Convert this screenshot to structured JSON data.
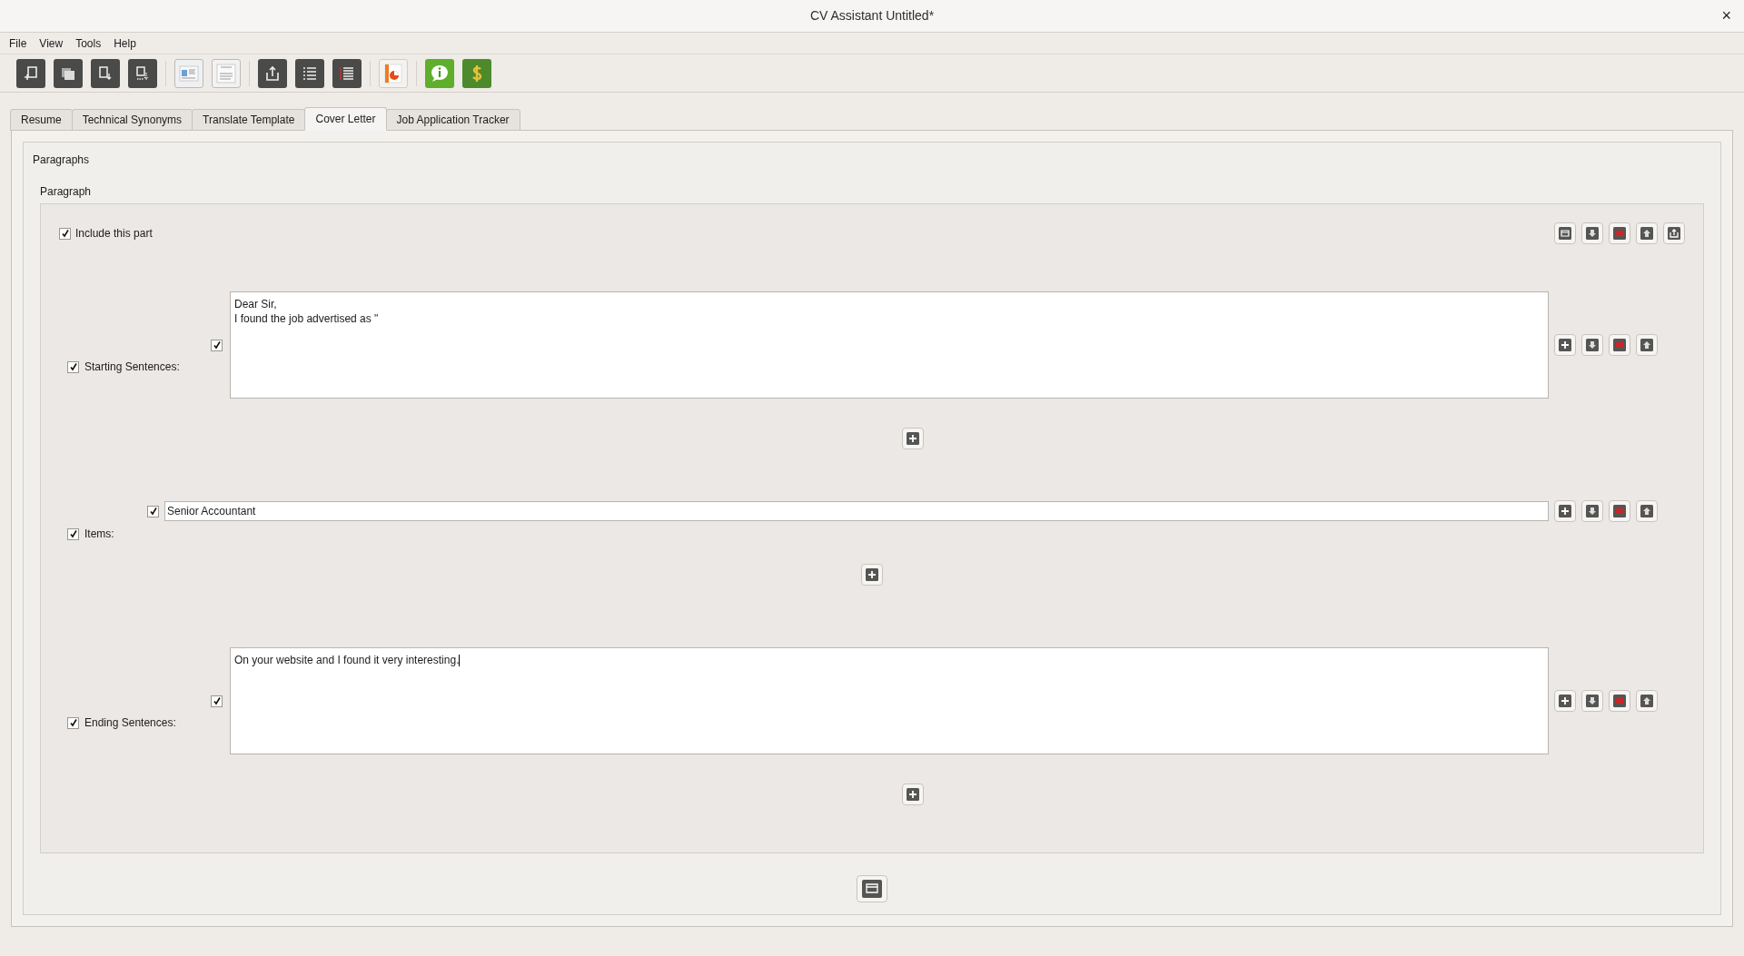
{
  "window": {
    "title": "CV Assistant Untitled*",
    "close": "×"
  },
  "menu": [
    "File",
    "View",
    "Tools",
    "Help"
  ],
  "tabs": [
    {
      "label": "Resume",
      "selected": false
    },
    {
      "label": "Technical Synonyms",
      "selected": false
    },
    {
      "label": "Translate Template",
      "selected": false
    },
    {
      "label": "Cover Letter",
      "selected": true
    },
    {
      "label": "Job Application Tracker",
      "selected": false
    }
  ],
  "paragraphs": {
    "title": "Paragraphs",
    "paragraph_title": "Paragraph",
    "include": {
      "label": "Include this part",
      "checked": true
    },
    "groups": [
      {
        "label": "Starting Sentences:",
        "checked": true,
        "kind": "multiline",
        "entries": [
          {
            "checked": true,
            "text": "Dear Sir,\nI found the job advertised as \"",
            "focused": false
          }
        ]
      },
      {
        "label": "Items:",
        "checked": true,
        "kind": "line",
        "entries": [
          {
            "checked": true,
            "text": "Senior Accountant",
            "focused": false
          }
        ]
      },
      {
        "label": "Ending Sentences:",
        "checked": true,
        "kind": "multiline",
        "entries": [
          {
            "checked": true,
            "text": "On your website and I found it very interesting.",
            "focused": true
          }
        ]
      }
    ]
  }
}
